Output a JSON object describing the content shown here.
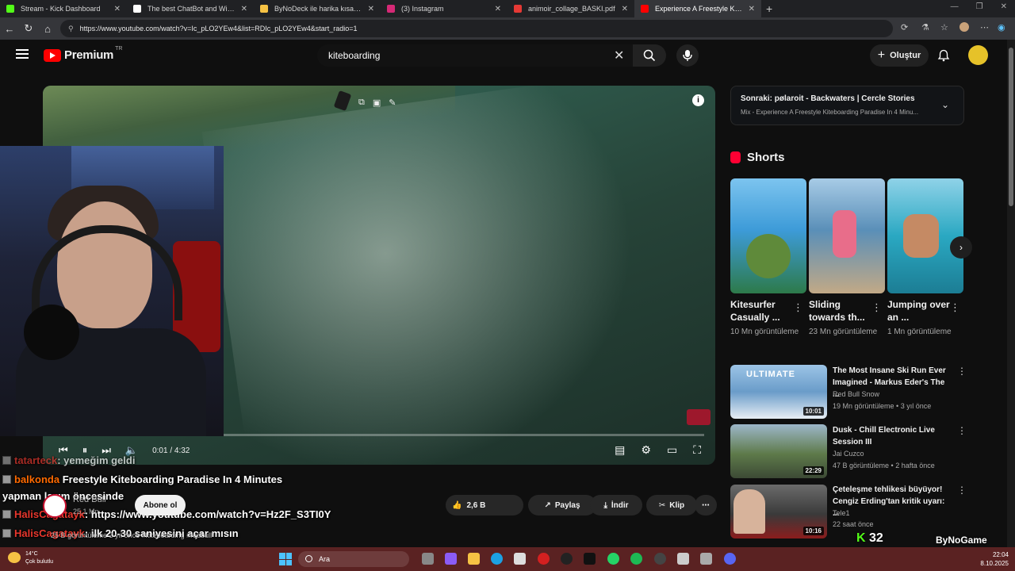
{
  "browser": {
    "tabs": [
      {
        "title": "Stream - Kick Dashboard",
        "color": "#53fc18",
        "active": false
      },
      {
        "title": "The best ChatBot and Widgets fo",
        "color": "#ffffff",
        "active": false
      },
      {
        "title": "ByNoDeck ile harika kısayollar y",
        "color": "#f6c244",
        "active": false
      },
      {
        "title": "(3) Instagram",
        "color": "#d62976",
        "active": false
      },
      {
        "title": "animoir_collage_BASKI.pdf",
        "color": "#e53935",
        "active": false
      },
      {
        "title": "Experience A Freestyle Kiteb",
        "color": "#ff0000",
        "active": true
      }
    ],
    "url": "https://www.youtube.com/watch?v=Ic_pLO2YEw4&list=RDIc_pLO2YEw4&start_radio=1"
  },
  "header": {
    "logo_text": "Premium",
    "region": "TR",
    "search_value": "kiteboarding",
    "create_label": "Oluştur",
    "avatar_color": "#e6c229"
  },
  "player": {
    "time": "0:01 / 4:32",
    "progress_fraction": 0.004
  },
  "chat": [
    {
      "user": "tatarteck",
      "message": ": yemeğim geldi",
      "user_color": "#e8372d"
    },
    {
      "user": "balkonda",
      "message": "Freestyle Kiteboarding Paradise In 4 Minutes",
      "user_color": "#ff6a00"
    },
    {
      "user": "",
      "message": "yapman lazım öncesinde",
      "user_color": "#ffffff"
    },
    {
      "user": "HalisCagatayk",
      "message": ": https://www.youtube.com/watch?v=Hz2F_S3TI0Y",
      "user_color": "#e8372d"
    },
    {
      "user": "HalisCagatayk",
      "message": ": ilk 20-30 saniyesini açar mısın",
      "user_color": "#e8372d"
    }
  ],
  "channel": {
    "name": "Red Bull",
    "subs": "25,1 Mn",
    "subscribe_label": "Abone ol",
    "views_line": "25 B görüntüleme  3 yıl önce  #kiteboarding #redbull"
  },
  "actions": {
    "likes": "2,6 B",
    "share": "Paylaş",
    "download": "İndir",
    "clip": "Klip"
  },
  "up_next": {
    "title": "Sonraki: pølaroit - Backwaters | Cercle Stories",
    "subtitle": "Mix - Experience A Freestyle Kiteboarding Paradise In 4 Minu..."
  },
  "shorts": {
    "heading": "Shorts",
    "items": [
      {
        "title": "Kitesurfer Casually ...",
        "views": "10 Mn görüntüleme",
        "bg": "#3d9bd8"
      },
      {
        "title": "Sliding towards th...",
        "views": "23 Mn görüntüleme",
        "bg": "#5a8fb8"
      },
      {
        "title": "Jumping over an ...",
        "views": "1 Mn görüntüleme",
        "bg": "#2aa8c2"
      }
    ]
  },
  "recommended": [
    {
      "title": "The Most Insane Ski Run Ever Imagined - Markus Eder's The ...",
      "channel": "Red Bull Snow",
      "meta": "19 Mn görüntüleme • 3 yıl önce",
      "duration": "10:01",
      "bg": "#6a9cc9"
    },
    {
      "title": "Dusk - Chill Electronic Live Session III",
      "channel": "Jai Cuzco",
      "meta": "47 B görüntüleme • 2 hafta önce",
      "duration": "22:29",
      "bg": "#5e7a4a"
    },
    {
      "title": "Çeteleşme tehlikesi büyüyor! Cengiz Erding'tan kritik uyarı: ...",
      "channel": "Tele1",
      "meta": "22 saat önce",
      "duration": "10:16",
      "bg": "#8b1d1d"
    }
  ],
  "overlay": {
    "kick_count": "32",
    "brand": "ByNoGame"
  },
  "taskbar": {
    "temperature": "14°C",
    "weather": "Çok bulutlu",
    "search_label": "Ara",
    "time": "22:04",
    "date": "8.10.2025"
  }
}
